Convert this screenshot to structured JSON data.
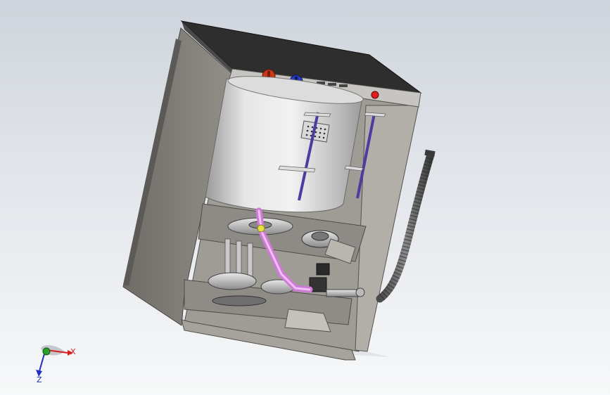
{
  "triad": {
    "x_label": "X",
    "z_label": "Z",
    "x_color": "#d62020",
    "y_color": "#2aa02a",
    "z_color": "#2030c0"
  },
  "colors": {
    "background_top": "#cfd4dc",
    "background_bottom": "#f7f8f9",
    "cabinet_top": "#2e2e2e",
    "cabinet_side": "#8c8983",
    "tub": "#c4c4c4",
    "pipe": "#d07ad8",
    "knob_left": "#c8381a",
    "knob_right": "#2a3cc0",
    "indicator": "#e02020",
    "rod": "#4a3ca0"
  }
}
